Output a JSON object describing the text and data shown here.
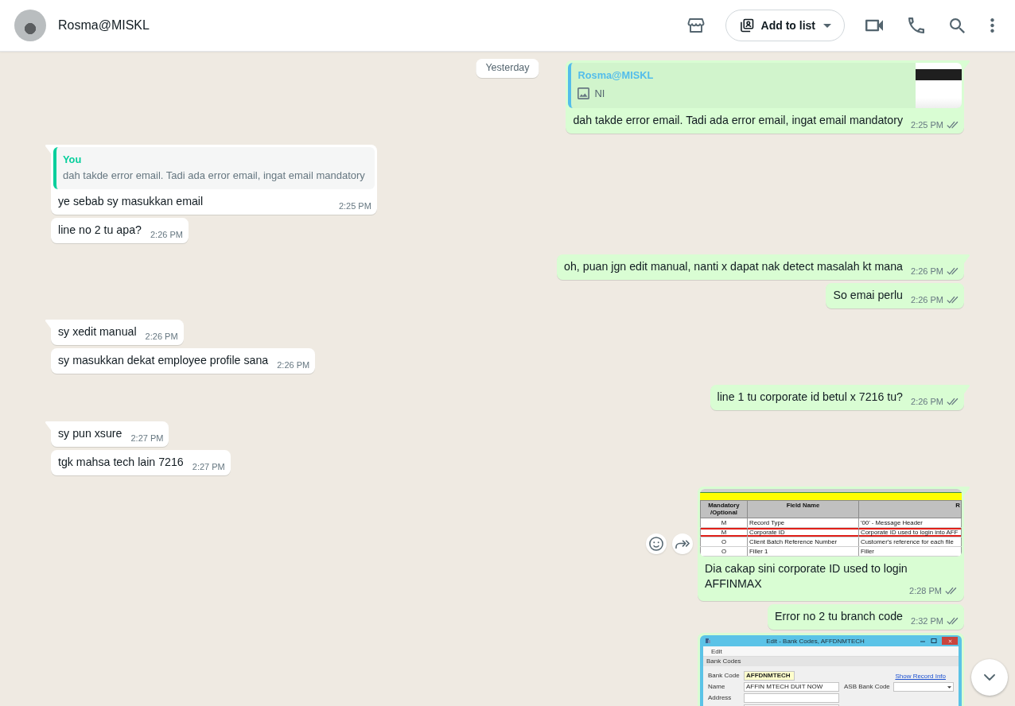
{
  "header": {
    "contact_name": "Rosma@MISKL",
    "add_to_list": "Add to list"
  },
  "date_chip": "Yesterday",
  "messages": [
    {
      "kind": "outgoing",
      "tail": true,
      "hover_actions": false,
      "quote": {
        "author": "Rosma@MISKL",
        "color": "#53bdeb",
        "kind": "photo",
        "text": "NI",
        "thumbnail": true
      },
      "text": "dah takde error email. Tadi ada error email, ingat email mandatory",
      "time": "2:25 PM",
      "read": false
    },
    {
      "kind": "incoming",
      "tail": true,
      "hover_actions": false,
      "quote": {
        "author": "You",
        "color": "#06cf9c",
        "text": "dah takde error email. Tadi ada error email, ingat email mandatory",
        "thumbnail": false
      },
      "text": "ye sebab sy masukkan email",
      "time": "2:25 PM"
    },
    {
      "kind": "incoming",
      "tail": false,
      "hover_actions": false,
      "text": "line no 2 tu apa?",
      "time": "2:26 PM"
    },
    {
      "kind": "outgoing",
      "tail": true,
      "hover_actions": false,
      "text": "oh, puan jgn edit manual, nanti x dapat nak detect masalah kt mana",
      "time": "2:26 PM",
      "read": false
    },
    {
      "kind": "outgoing",
      "tail": false,
      "hover_actions": false,
      "text": "So emai perlu",
      "time": "2:26 PM",
      "read": false
    },
    {
      "kind": "incoming",
      "tail": true,
      "hover_actions": false,
      "text": "sy xedit manual",
      "time": "2:26 PM"
    },
    {
      "kind": "incoming",
      "tail": false,
      "hover_actions": false,
      "text": "sy masukkan dekat employee profile sana",
      "time": "2:26 PM"
    },
    {
      "kind": "outgoing",
      "tail": true,
      "hover_actions": false,
      "text": "line 1 tu corporate id betul x 7216 tu?",
      "time": "2:26 PM",
      "read": false
    },
    {
      "kind": "incoming",
      "tail": true,
      "hover_actions": false,
      "text": "sy pun xsure",
      "time": "2:27 PM"
    },
    {
      "kind": "incoming",
      "tail": false,
      "hover_actions": false,
      "text": "tgk mahsa tech lain 7216",
      "time": "2:27 PM"
    },
    {
      "kind": "outgoing",
      "tail": true,
      "hover_actions": true,
      "image": {
        "kind": "table",
        "columns": [
          "Mandatory /Optional",
          "Field Name",
          "R"
        ],
        "rows": [
          {
            "cells": [
              "M",
              "Record Type",
              "'00' - Message Header"
            ],
            "highlighted": false
          },
          {
            "cells": [
              "M",
              "Corporate ID",
              "Corporate ID used to login into AFF"
            ],
            "highlighted": true
          },
          {
            "cells": [
              "O",
              "Client Batch Reference Number",
              "Customer's reference for each file"
            ],
            "highlighted": false
          },
          {
            "cells": [
              "O",
              "Filler 1",
              "Filler"
            ],
            "highlighted": false
          }
        ]
      },
      "text": "Dia cakap sini corporate ID used to login AFFINMAX",
      "time": "2:28 PM",
      "read": false
    },
    {
      "kind": "outgoing",
      "tail": false,
      "hover_actions": false,
      "text": "Error no 2 tu branch code",
      "time": "2:32 PM",
      "read": false
    },
    {
      "kind": "outgoing",
      "tail": false,
      "hover_actions": false,
      "image": {
        "kind": "window",
        "title": "Edit - Bank Codes, AFFDNMTECH",
        "menu": [
          "Edit"
        ],
        "section": "Bank Codes",
        "link": "Show Record Info",
        "fields": [
          {
            "label": "Bank Code",
            "value": "AFFDNMTECH",
            "kind": "short",
            "highlighted": true
          },
          {
            "label": "Name",
            "value": "AFFIN MTECH DUIT NOW",
            "kind": "text",
            "highlighted": false
          },
          {
            "label": "Address",
            "kind": "multiline",
            "highlighted": false
          }
        ],
        "side_field": {
          "label": "ASB Bank Code",
          "kind": "dropdown"
        }
      }
    }
  ]
}
